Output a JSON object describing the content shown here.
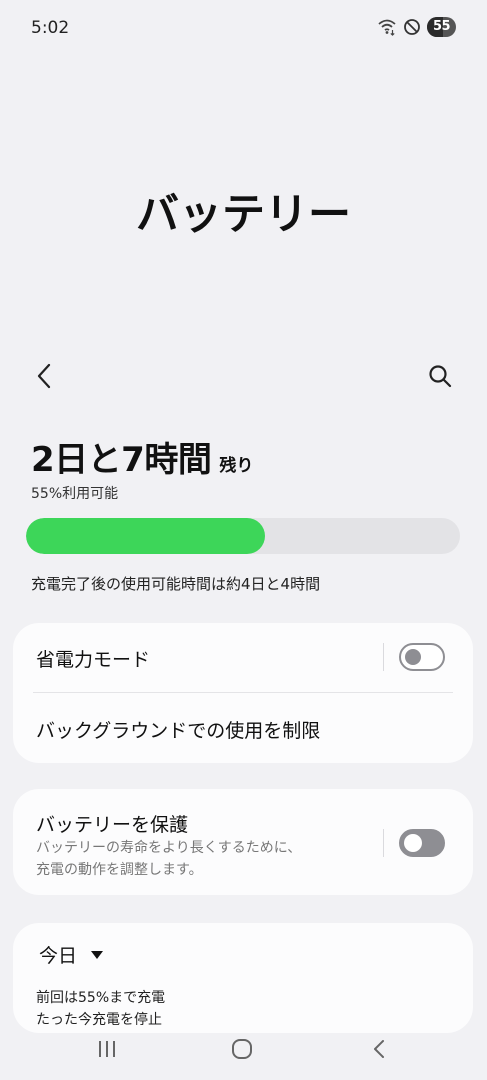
{
  "status_bar": {
    "time": "5:02",
    "battery_level": "55",
    "icons": [
      "wifi-icon",
      "do-not-disturb-icon",
      "battery-icon"
    ]
  },
  "header": {
    "title": "バッテリー"
  },
  "battery": {
    "remaining_time": "2日と7時間",
    "remaining_suffix": "残り",
    "available_text": "55%利用可能",
    "level_percent": 55,
    "full_charge_text": "充電完了後の使用可能時間は約4日と4時間",
    "bar_color": "#3dd659"
  },
  "settings": {
    "power_saving": {
      "label": "省電力モード",
      "enabled": false
    },
    "background_limit": {
      "label": "バックグラウンドでの使用を制限"
    },
    "protect_battery": {
      "label": "バッテリーを保護",
      "description_line1": "バッテリーの寿命をより長くするために、",
      "description_line2": "充電の動作を調整します。",
      "enabled": false
    }
  },
  "usage": {
    "period_label": "今日",
    "last_charge_line": "前回は55%まで充電",
    "partial_line": "たった今充電を停止"
  },
  "nav_bar": {
    "icons": [
      "recent-apps-icon",
      "home-icon",
      "back-icon"
    ]
  }
}
